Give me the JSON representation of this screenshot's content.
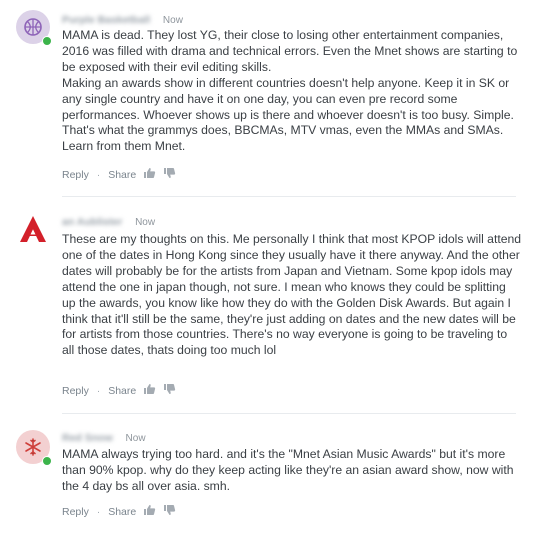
{
  "action_labels": {
    "reply": "Reply",
    "share": "Share",
    "separator": "·"
  },
  "comments": [
    {
      "author": "Purple Basketball",
      "time": "Now",
      "avatar_icon": "basketball-icon",
      "avatar_bg": "#d9cfe6",
      "avatar_fg": "#8e64b8",
      "paragraphs": [
        "MAMA is dead. They lost YG, their close to losing other entertainment companies, 2016 was filled with drama and technical errors. Even the Mnet shows are starting to be exposed with their evil editing skills.",
        "Making an awards show in different countries doesn't help anyone. Keep it in SK or any single country and have it on one day, you can even pre record some performances. Whoever shows up is there and whoever doesn't is too busy. Simple. That's what the grammys does, BBCMAs, MTV vmas, even the MMAs and SMAs. Learn from them Mnet."
      ]
    },
    {
      "author": "an Aublister",
      "time": "Now",
      "avatar_icon": "red-a-logo-icon",
      "avatar_bg": "#ffffff",
      "avatar_fg": "#d3202a",
      "paragraphs": [
        "These are my thoughts on this. Me personally I think that most KPOP idols will attend one of the dates in Hong Kong since they usually have it there anyway. And the other dates will probably be for the artists from Japan and Vietnam. Some kpop idols may attend the one in japan though, not sure. I mean who knows they could be splitting up the awards, you know like how they do with the Golden Disk Awards. But again I think that it'll still be the same, they're just adding on dates and the new dates will be for artists from those countries. There's no way everyone is going to be traveling to all those dates, thats doing too much lol"
      ]
    },
    {
      "author": "Red Snow",
      "time": "Now",
      "avatar_icon": "snowflake-icon",
      "avatar_bg": "#f3cfd0",
      "avatar_fg": "#d0453f",
      "paragraphs": [
        "MAMA always trying too hard. and it's the \"Mnet Asian Music Awards\" but it's more than 90% kpop. why do they keep acting like they're an asian award show, now with the 4 day bs all over asia. smh."
      ]
    }
  ],
  "colors": {
    "online": "#3cb44b",
    "meta": "#8e959c",
    "body_text": "#3a3f44",
    "divider": "#e8ebee"
  }
}
